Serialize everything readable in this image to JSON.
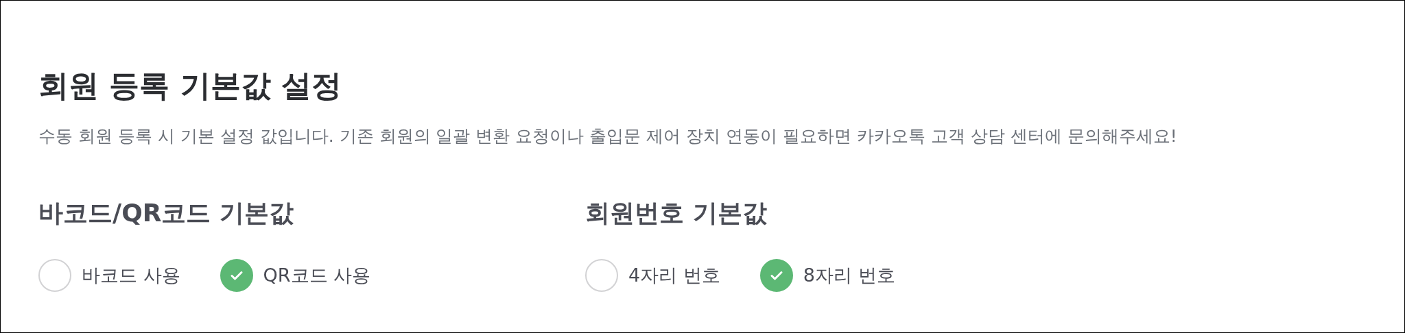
{
  "title": "회원 등록 기본값 설정",
  "description": "수동 회원 등록 시 기본 설정 값입니다. 기존 회원의 일괄 변환 요청이나 출입문 제어 장치 연동이 필요하면 카카오톡 고객 상담 센터에 문의해주세요!",
  "sections": [
    {
      "heading": "바코드/QR코드 기본값",
      "options": [
        {
          "label": "바코드 사용",
          "selected": false
        },
        {
          "label": "QR코드 사용",
          "selected": true
        }
      ]
    },
    {
      "heading": "회원번호 기본값",
      "options": [
        {
          "label": "4자리 번호",
          "selected": false
        },
        {
          "label": "8자리 번호",
          "selected": true
        }
      ]
    }
  ]
}
